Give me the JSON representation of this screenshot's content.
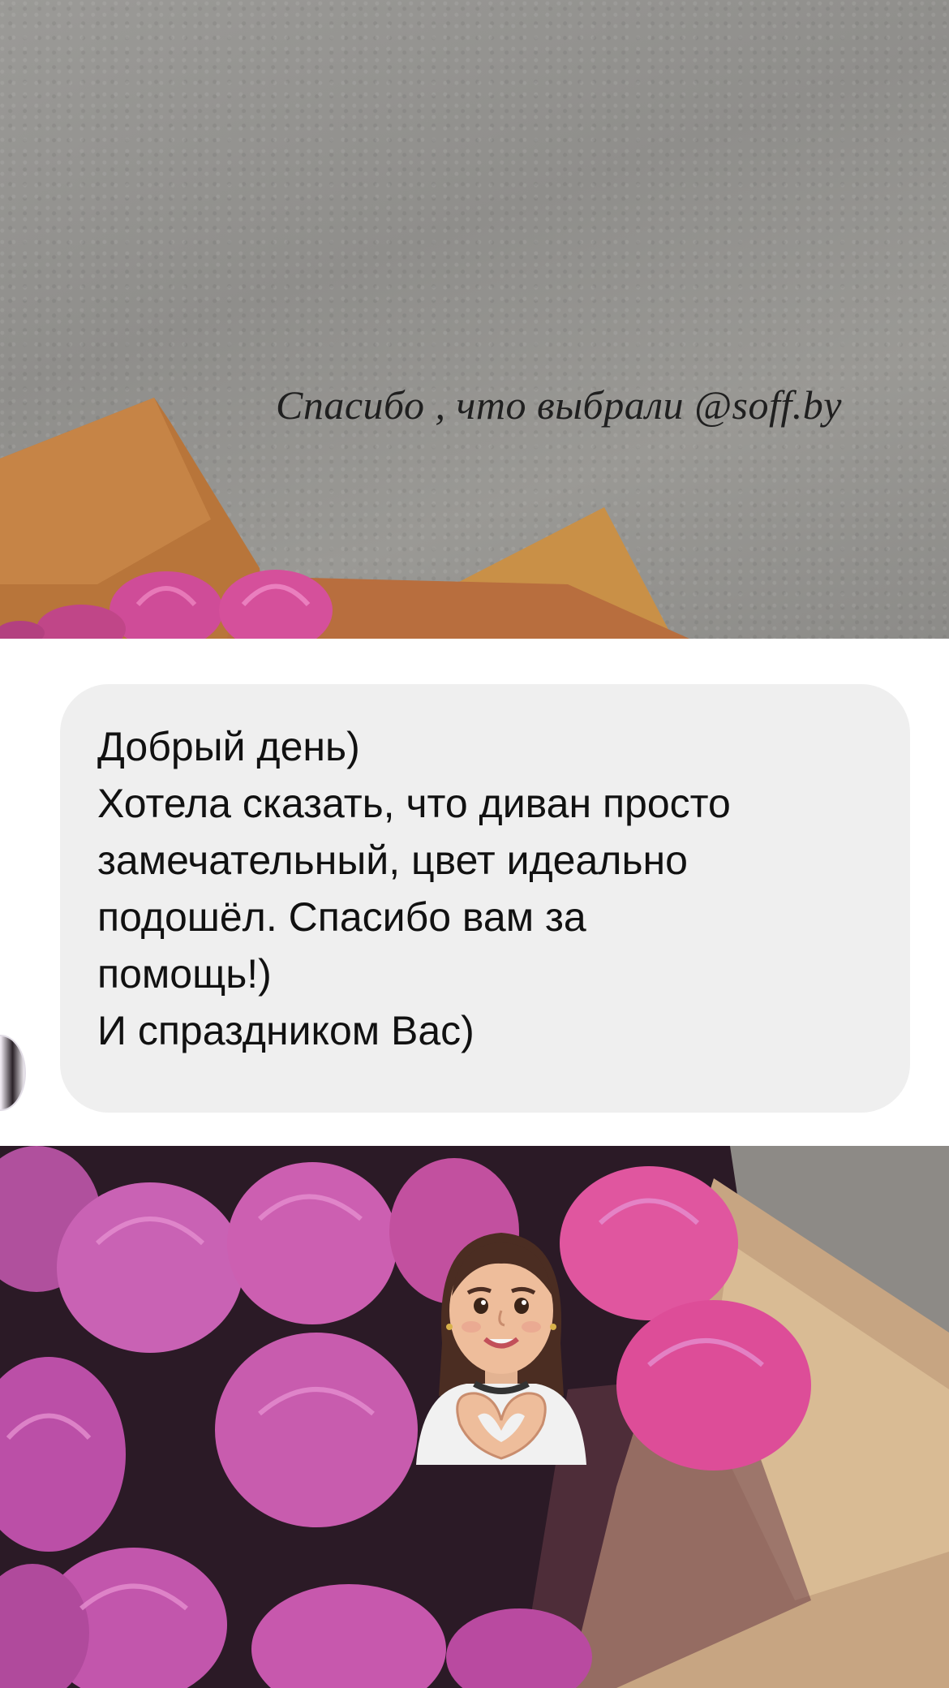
{
  "top_photo": {
    "caption": "Спасибо , что выбрали @soff.by"
  },
  "message": {
    "lines": [
      "Добрый день)",
      "Хотела сказать, что диван просто",
      "замечательный, цвет идеально",
      "подошёл. Спасибо вам за",
      "помощь!)",
      "И спраздником Вас)"
    ]
  },
  "sticker": {
    "icon": "memoji-heart-hands-icon"
  },
  "colors": {
    "bubble_bg": "#efefef",
    "text": "#111111",
    "tulip_pink": "#d84fa8"
  }
}
